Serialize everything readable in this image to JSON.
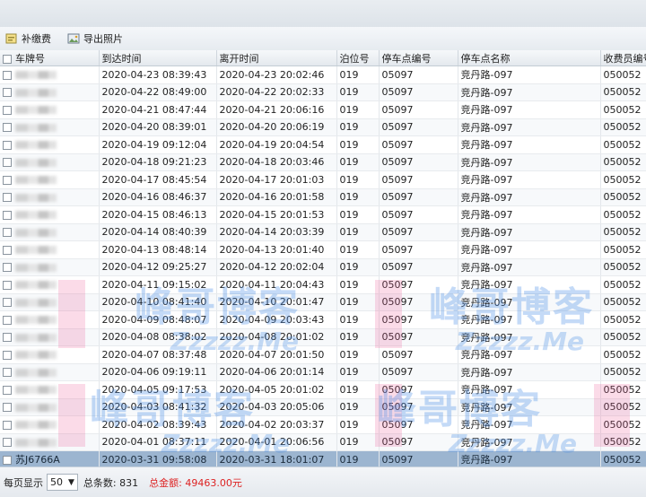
{
  "toolbar": {
    "supplement_label": "补缴费",
    "export_label": "导出照片"
  },
  "table": {
    "columns": [
      "车牌号",
      "到达时间",
      "离开时间",
      "泊位号",
      "停车点编号",
      "停车点名称",
      "收费员编号"
    ],
    "rows": [
      [
        "",
        "2020-04-23 08:39:43",
        "2020-04-23 20:02:46",
        "019",
        "05097",
        "竞丹路-097",
        "050052"
      ],
      [
        "",
        "2020-04-22 08:49:00",
        "2020-04-22 20:02:33",
        "019",
        "05097",
        "竞丹路-097",
        "050052"
      ],
      [
        "",
        "2020-04-21 08:47:44",
        "2020-04-21 20:06:16",
        "019",
        "05097",
        "竞丹路-097",
        "050052"
      ],
      [
        "",
        "2020-04-20 08:39:01",
        "2020-04-20 20:06:19",
        "019",
        "05097",
        "竞丹路-097",
        "050052"
      ],
      [
        "",
        "2020-04-19 09:12:04",
        "2020-04-19 20:04:54",
        "019",
        "05097",
        "竞丹路-097",
        "050052"
      ],
      [
        "",
        "2020-04-18 09:21:23",
        "2020-04-18 20:03:46",
        "019",
        "05097",
        "竞丹路-097",
        "050052"
      ],
      [
        "",
        "2020-04-17 08:45:54",
        "2020-04-17 20:01:03",
        "019",
        "05097",
        "竞丹路-097",
        "050052"
      ],
      [
        "",
        "2020-04-16 08:46:37",
        "2020-04-16 20:01:58",
        "019",
        "05097",
        "竞丹路-097",
        "050052"
      ],
      [
        "",
        "2020-04-15 08:46:13",
        "2020-04-15 20:01:53",
        "019",
        "05097",
        "竞丹路-097",
        "050052"
      ],
      [
        "",
        "2020-04-14 08:40:39",
        "2020-04-14 20:03:39",
        "019",
        "05097",
        "竞丹路-097",
        "050052"
      ],
      [
        "",
        "2020-04-13 08:48:14",
        "2020-04-13 20:01:40",
        "019",
        "05097",
        "竞丹路-097",
        "050052"
      ],
      [
        "",
        "2020-04-12 09:25:27",
        "2020-04-12 20:02:04",
        "019",
        "05097",
        "竞丹路-097",
        "050052"
      ],
      [
        "",
        "2020-04-11 09:15:02",
        "2020-04-11 20:04:43",
        "019",
        "05097",
        "竞丹路-097",
        "050052"
      ],
      [
        "",
        "2020-04-10 08:41:40",
        "2020-04-10 20:01:47",
        "019",
        "05097",
        "竞丹路-097",
        "050052"
      ],
      [
        "",
        "2020-04-09 08:48:07",
        "2020-04-09 20:03:43",
        "019",
        "05097",
        "竞丹路-097",
        "050052"
      ],
      [
        "",
        "2020-04-08 08:38:02",
        "2020-04-08 20:01:02",
        "019",
        "05097",
        "竞丹路-097",
        "050052"
      ],
      [
        "",
        "2020-04-07 08:37:48",
        "2020-04-07 20:01:50",
        "019",
        "05097",
        "竞丹路-097",
        "050052"
      ],
      [
        "",
        "2020-04-06 09:19:11",
        "2020-04-06 20:01:14",
        "019",
        "05097",
        "竞丹路-097",
        "050052"
      ],
      [
        "",
        "2020-04-05 09:17:53",
        "2020-04-05 20:01:02",
        "019",
        "05097",
        "竞丹路-097",
        "050052"
      ],
      [
        "",
        "2020-04-03 08:41:32",
        "2020-04-03 20:05:06",
        "019",
        "05097",
        "竞丹路-097",
        "050052"
      ],
      [
        "",
        "2020-04-02 08:39:43",
        "2020-04-02 20:03:37",
        "019",
        "05097",
        "竞丹路-097",
        "050052"
      ],
      [
        "",
        "2020-04-01 08:37:11",
        "2020-04-01 20:06:56",
        "019",
        "05097",
        "竞丹路-097",
        "050052"
      ],
      [
        "苏J6766A",
        "2020-03-31 09:58:08",
        "2020-03-31 18:01:07",
        "019",
        "05097",
        "竞丹路-097",
        "050052"
      ]
    ],
    "selected_row": 22
  },
  "footer": {
    "page_size_label": "每页显示",
    "page_size_value": "50",
    "total_count_text": "总条数: 831",
    "total_amount_text": "总金额: 49463.00元"
  },
  "watermarks": [
    "峰哥博客",
    "Zzzzz.Me"
  ],
  "colors": {
    "selected_row": "#9cb5d0",
    "amount_text": "#dd2222",
    "watermark_blue": "#468ce6",
    "watermark_pink": "#eb5a96"
  }
}
